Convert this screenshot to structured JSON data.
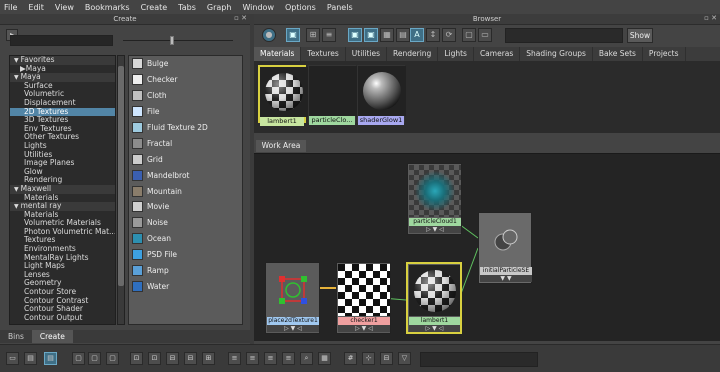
{
  "menu": [
    "File",
    "Edit",
    "View",
    "Bookmarks",
    "Create",
    "Tabs",
    "Graph",
    "Window",
    "Options",
    "Panels"
  ],
  "create_panel": {
    "title": "Create",
    "tree": [
      {
        "label": "Favorites",
        "type": "cat",
        "arrow": "▼"
      },
      {
        "label": "Maya",
        "type": "sub",
        "arrow": "▶"
      },
      {
        "label": "Maya",
        "type": "cat",
        "arrow": "▼"
      },
      {
        "label": "Surface",
        "type": "item"
      },
      {
        "label": "Volumetric",
        "type": "item"
      },
      {
        "label": "Displacement",
        "type": "item"
      },
      {
        "label": "2D Textures",
        "type": "item",
        "selected": true
      },
      {
        "label": "3D Textures",
        "type": "item"
      },
      {
        "label": "Env Textures",
        "type": "item"
      },
      {
        "label": "Other Textures",
        "type": "item"
      },
      {
        "label": "Lights",
        "type": "item"
      },
      {
        "label": "Utilities",
        "type": "item"
      },
      {
        "label": "Image Planes",
        "type": "item"
      },
      {
        "label": "Glow",
        "type": "item"
      },
      {
        "label": "Rendering",
        "type": "item"
      },
      {
        "label": "Maxwell",
        "type": "cat",
        "arrow": "▼"
      },
      {
        "label": "Materials",
        "type": "item"
      },
      {
        "label": "mental ray",
        "type": "cat",
        "arrow": "▼"
      },
      {
        "label": "Materials",
        "type": "item"
      },
      {
        "label": "Volumetric Materials",
        "type": "item"
      },
      {
        "label": "Photon Volumetric Mat...",
        "type": "item"
      },
      {
        "label": "Textures",
        "type": "item"
      },
      {
        "label": "Environments",
        "type": "item"
      },
      {
        "label": "MentalRay Lights",
        "type": "item"
      },
      {
        "label": "Light Maps",
        "type": "item"
      },
      {
        "label": "Lenses",
        "type": "item"
      },
      {
        "label": "Geometry",
        "type": "item"
      },
      {
        "label": "Contour Store",
        "type": "item"
      },
      {
        "label": "Contour Contrast",
        "type": "item"
      },
      {
        "label": "Contour Shader",
        "type": "item"
      },
      {
        "label": "Contour Output",
        "type": "item"
      }
    ],
    "nodes": [
      {
        "label": "Bulge",
        "icon": "bulge-icon",
        "color": "#d8d8d8"
      },
      {
        "label": "Checker",
        "icon": "checker-icon",
        "color": "#eeeeee"
      },
      {
        "label": "Cloth",
        "icon": "cloth-icon",
        "color": "#bfbfbf"
      },
      {
        "label": "File",
        "icon": "file-icon",
        "color": "#cfe6ff"
      },
      {
        "label": "Fluid Texture 2D",
        "icon": "fluid-texture-icon",
        "color": "#9ecbe0"
      },
      {
        "label": "Fractal",
        "icon": "fractal-icon",
        "color": "#8c8c8c"
      },
      {
        "label": "Grid",
        "icon": "grid-icon",
        "color": "#cccccc"
      },
      {
        "label": "Mandelbrot",
        "icon": "mandelbrot-icon",
        "color": "#3a5fb0"
      },
      {
        "label": "Mountain",
        "icon": "mountain-icon",
        "color": "#8a7d6b"
      },
      {
        "label": "Movie",
        "icon": "movie-icon",
        "color": "#d0d0d0"
      },
      {
        "label": "Noise",
        "icon": "noise-icon",
        "color": "#9a9a9a"
      },
      {
        "label": "Ocean",
        "icon": "ocean-icon",
        "color": "#2d8fb0"
      },
      {
        "label": "PSD File",
        "icon": "psd-file-icon",
        "color": "#3da0e0"
      },
      {
        "label": "Ramp",
        "icon": "ramp-icon",
        "color": "#5aa0d8"
      },
      {
        "label": "Water",
        "icon": "water-icon",
        "color": "#2f6fbf"
      }
    ],
    "tabs": [
      "Bins",
      "Create"
    ]
  },
  "browser": {
    "title": "Browser",
    "show_label": "Show",
    "tabs": [
      "Materials",
      "Textures",
      "Utilities",
      "Rendering",
      "Lights",
      "Cameras",
      "Shading Groups",
      "Bake Sets",
      "Projects"
    ],
    "swatches": [
      {
        "label": "lambert1",
        "label_color": "#c8e6a0",
        "border": "#d8d040"
      },
      {
        "label": "particleClo...",
        "label_color": "#9fd89f",
        "border": "#333333"
      },
      {
        "label": "shaderGlow1",
        "label_color": "#a8a8f0",
        "border": "#333333"
      }
    ],
    "work_area_tab": "Work Area",
    "nodes": {
      "particleCloud1": "particleCloud1",
      "initialParticleSE": "initialParticleSE",
      "place2dTexture1": "place2dTexture1",
      "checker1": "checker1",
      "lambert1": "lambert1"
    },
    "colors": {
      "material_label": "#9fd89f",
      "texture_label": "#f0a0a0",
      "utility_label": "#a0c8f0",
      "se_label": "#c8c8c8"
    }
  }
}
